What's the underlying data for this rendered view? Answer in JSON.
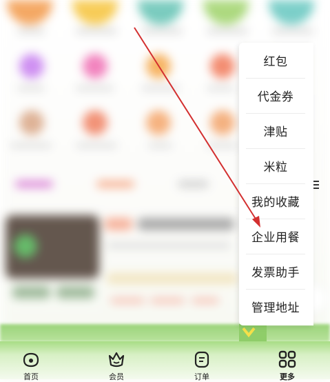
{
  "menu": {
    "items": [
      {
        "label": "红包"
      },
      {
        "label": "代金券"
      },
      {
        "label": "津贴"
      },
      {
        "label": "米粒"
      },
      {
        "label": "我的收藏"
      },
      {
        "label": "企业用餐"
      },
      {
        "label": "发票助手"
      },
      {
        "label": "管理地址"
      }
    ]
  },
  "bottom_nav": {
    "items": [
      {
        "label": "首页",
        "icon": "home-icon"
      },
      {
        "label": "会员",
        "icon": "crown-icon"
      },
      {
        "label": "订单",
        "icon": "order-icon"
      },
      {
        "label": "更多",
        "icon": "grid-icon",
        "active": true
      }
    ]
  },
  "colors": {
    "accent_green": "#9bd37a",
    "arrow_red": "#d32f2f",
    "nav_gradient_top": "#a8dc85"
  }
}
